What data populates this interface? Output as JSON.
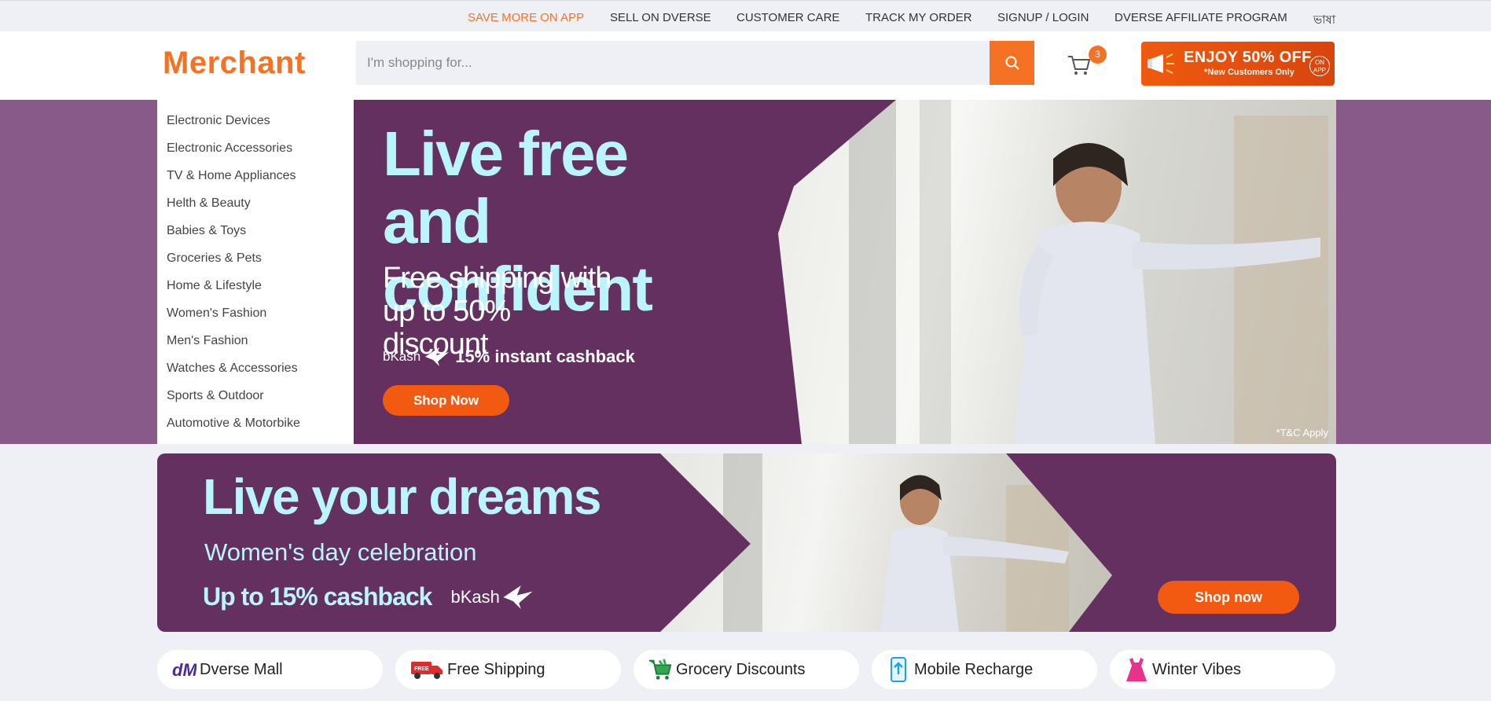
{
  "topbar": {
    "links": [
      {
        "label": "SAVE MORE ON APP"
      },
      {
        "label": "SELL ON DVERSE"
      },
      {
        "label": "CUSTOMER CARE"
      },
      {
        "label": "TRACK MY ORDER"
      },
      {
        "label": "SIGNUP / LOGIN"
      },
      {
        "label": "DVERSE AFFILIATE PROGRAM"
      },
      {
        "label": "ভাষা"
      }
    ]
  },
  "header": {
    "logo": "Merchant",
    "search": {
      "placeholder": "I'm shopping for...",
      "value": ""
    },
    "cart_count": "3",
    "promo": {
      "title": "ENJOY 50% OFF",
      "subtitle": "*New Customers Only",
      "badge": "ON APP"
    }
  },
  "categories": [
    "Electronic Devices",
    "Electronic Accessories",
    "TV & Home Appliances",
    "Helth & Beauty",
    "Babies & Toys",
    "Groceries & Pets",
    "Home & Lifestyle",
    "Women's Fashion",
    "Men's Fashion",
    "Watches & Accessories",
    "Sports & Outdoor",
    "Automotive & Motorbike"
  ],
  "hero": {
    "headline": "Live free and confident",
    "subline": "Free shipping with up to 50% discount",
    "bkash": "bKash",
    "cashback": "15% instant cashback",
    "button": "Shop Now",
    "terms": "*T&C Apply"
  },
  "banner2": {
    "headline": "Live your dreams",
    "subline": "Women's day celebration",
    "cashback": "Up to 15% cashback",
    "bkash": "bKash",
    "button": "Shop now"
  },
  "quick_links": [
    {
      "label": "Dverse Mall",
      "icon": "dm-logo-icon"
    },
    {
      "label": "Free Shipping",
      "icon": "delivery-truck-icon"
    },
    {
      "label": "Grocery Discounts",
      "icon": "shopping-cart-icon"
    },
    {
      "label": "Mobile Recharge",
      "icon": "mobile-recharge-icon"
    },
    {
      "label": "Winter Vibes",
      "icon": "dress-icon"
    }
  ],
  "colors": {
    "accent": "#f57224",
    "banner_purple": "#63305f",
    "hero_bg": "#885a8a",
    "headline_cyan": "#b9f5fa"
  }
}
